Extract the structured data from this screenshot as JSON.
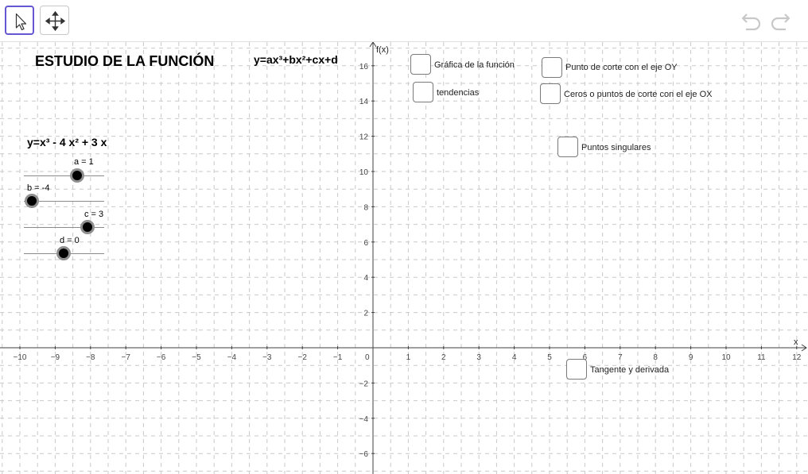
{
  "toolbar": {
    "tools": [
      {
        "name": "move-tool",
        "icon": "cursor-arrow-icon",
        "active": true
      },
      {
        "name": "move-graphics-view-tool",
        "icon": "move-arrows-icon",
        "active": false
      }
    ],
    "undo_icon": "undo-icon",
    "redo_icon": "redo-icon"
  },
  "worksheet": {
    "title": "ESTUDIO DE LA FUNCIÓN",
    "general_formula": "y=ax³+bx²+cx+d",
    "current_formula": "y=x³ - 4 x² + 3 x"
  },
  "sliders": [
    {
      "label": "a = 1",
      "value": 1
    },
    {
      "label": "b = -4",
      "value": -4
    },
    {
      "label": "c = 3",
      "value": 3
    },
    {
      "label": "d = 0",
      "value": 0
    }
  ],
  "checkboxes": [
    {
      "label": "Gráfica de la función",
      "checked": false
    },
    {
      "label": "tendencias",
      "checked": false
    },
    {
      "label": "Punto de corte con el eje OY",
      "checked": false
    },
    {
      "label": "Ceros o puntos de corte con el eje OX",
      "checked": false
    },
    {
      "label": "Puntos singulares",
      "checked": false
    },
    {
      "label": "Tangente y derivada",
      "checked": false
    }
  ],
  "axes": {
    "x_label": "x",
    "y_label": "f(x)",
    "x_ticks": [
      "−10",
      "−9",
      "−8",
      "−7",
      "−6",
      "−5",
      "−4",
      "−3",
      "−2",
      "−1",
      "0",
      "1",
      "2",
      "3",
      "4",
      "5",
      "6",
      "7",
      "8",
      "9",
      "10",
      "11",
      "12"
    ],
    "y_ticks": [
      "16",
      "14",
      "12",
      "10",
      "8",
      "6",
      "4",
      "2",
      "−2",
      "−4",
      "−6"
    ]
  },
  "colors": {
    "active_tool": "#6557d2",
    "grid": "#c9c9c9",
    "axis": "#404040"
  }
}
